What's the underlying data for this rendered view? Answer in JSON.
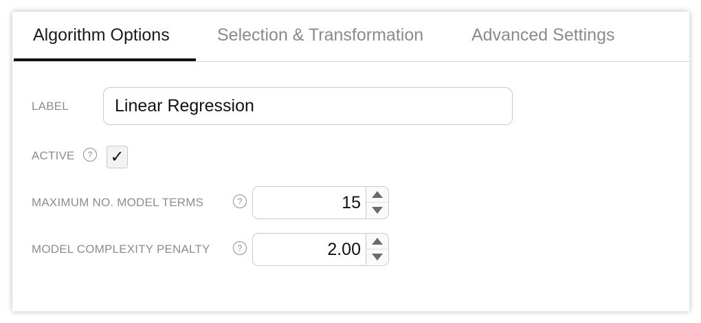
{
  "tabs": [
    {
      "label": "Algorithm Options",
      "active": true
    },
    {
      "label": "Selection & Transformation",
      "active": false
    },
    {
      "label": "Advanced Settings",
      "active": false
    }
  ],
  "form": {
    "label_field": {
      "label": "LABEL",
      "value": "Linear Regression"
    },
    "active_field": {
      "label": "ACTIVE",
      "checked": true,
      "check_glyph": "✓"
    },
    "max_terms_field": {
      "label": "MAXIMUM NO. MODEL TERMS",
      "value": "15"
    },
    "penalty_field": {
      "label": "MODEL COMPLEXITY PENALTY",
      "value": "2.00"
    },
    "help_glyph": "?"
  },
  "colors": {
    "active_tab_text": "#1a1a1a",
    "inactive_tab_text": "#8a8a8a",
    "active_tab_underline": "#111111",
    "label_text": "#8c8c8c",
    "border": "#c9c9c9"
  },
  "icons": {
    "help": "question-circle-icon",
    "checkmark": "checkmark-icon",
    "increment": "triangle-up-icon",
    "decrement": "triangle-down-icon"
  }
}
